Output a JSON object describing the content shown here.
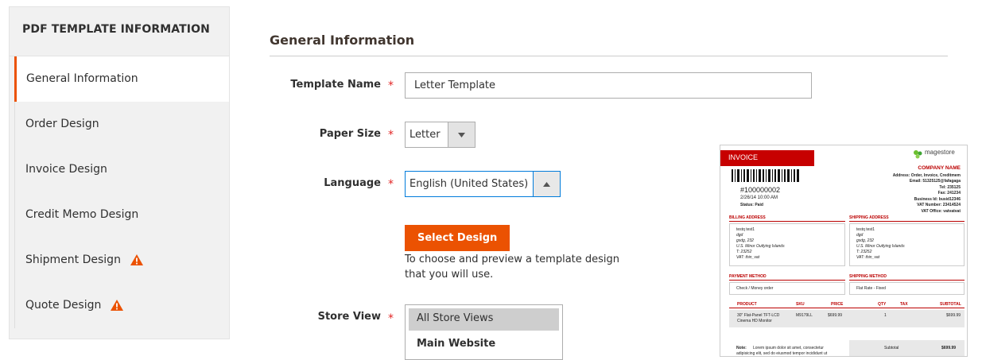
{
  "sidebar": {
    "title": "PDF TEMPLATE INFORMATION",
    "items": [
      {
        "label": "General Information",
        "active": true,
        "warning": false
      },
      {
        "label": "Order Design",
        "active": false,
        "warning": false
      },
      {
        "label": "Invoice Design",
        "active": false,
        "warning": false
      },
      {
        "label": "Credit Memo Design",
        "active": false,
        "warning": false
      },
      {
        "label": "Shipment Design",
        "active": false,
        "warning": true
      },
      {
        "label": "Quote Design",
        "active": false,
        "warning": true
      }
    ]
  },
  "main": {
    "section_title": "General Information",
    "template_name": {
      "label": "Template Name",
      "value": "Letter Template",
      "required": "*"
    },
    "paper_size": {
      "label": "Paper Size",
      "value": "Letter",
      "required": "*"
    },
    "language": {
      "label": "Language",
      "value": "English (United States)",
      "required": "*"
    },
    "select_design": {
      "label": "Select Design",
      "note": "To choose and preview a template design that you will use.",
      "note_line1": "To choose and preview a template design",
      "note_line2": "that you will use."
    },
    "store_view": {
      "label": "Store View",
      "required": "*",
      "options": [
        "All Store Views",
        "Main Website"
      ],
      "selected": "All Store Views"
    }
  },
  "preview": {
    "title": "INVOICE",
    "logo": "magestore",
    "company_name": "COMPANY NAME",
    "address": "Address: Order, Invoice, Creditmem",
    "email": "Email: 51325125@fafagaga",
    "tel": "Tel: 235125",
    "fax": "Fax: 241234",
    "business_id": "Business Id: busid12346",
    "vat_number": "VAT Number: 23414524",
    "vat_office": "VAT Office: vatvatvat",
    "invoice_number": "#100000002",
    "date": "2/26/14 10:00 AM",
    "status": "Status: Paid",
    "billing_header": "BILLING ADDRESS",
    "shipping_header": "SHIPPING ADDRESS",
    "address_lines": [
      "testq test1",
      "dgd",
      "gsdg, 232",
      "U.S. Minor Outlying Islands",
      "T: 23252",
      "VAT: thin_vat"
    ],
    "payment_header": "PAYMENT METHOD",
    "payment_value": "Check / Money order",
    "shipping_method_header": "SHIPPING METHOD",
    "shipping_method_value": "Flat Rate - Fixed",
    "table_headers": [
      "PRODUCT",
      "SKU",
      "PRICE",
      "QTY",
      "TAX",
      "SUBTOTAL"
    ],
    "product_line1": "30\" Flat-Panel TFT-LCD",
    "product_line2": "Cinema HD Monitor",
    "product_sku": "M9179LL",
    "product_price": "$699.99",
    "product_qty": "1",
    "product_subtotal": "$699.99",
    "note_label": "Note:",
    "note_line1": "Lorem ipsum dolor sit amet, consectetur",
    "note_line2": "adipisicing elit, sed do eiusmod tempor incididunt ut",
    "subtotal_label": "Subtotal",
    "subtotal_value": "$699.99"
  },
  "colors": {
    "accent": "#eb5202",
    "warning": "#eb5202",
    "required": "#e22626",
    "focus": "#007bdb",
    "invoice_red": "#c70000"
  }
}
